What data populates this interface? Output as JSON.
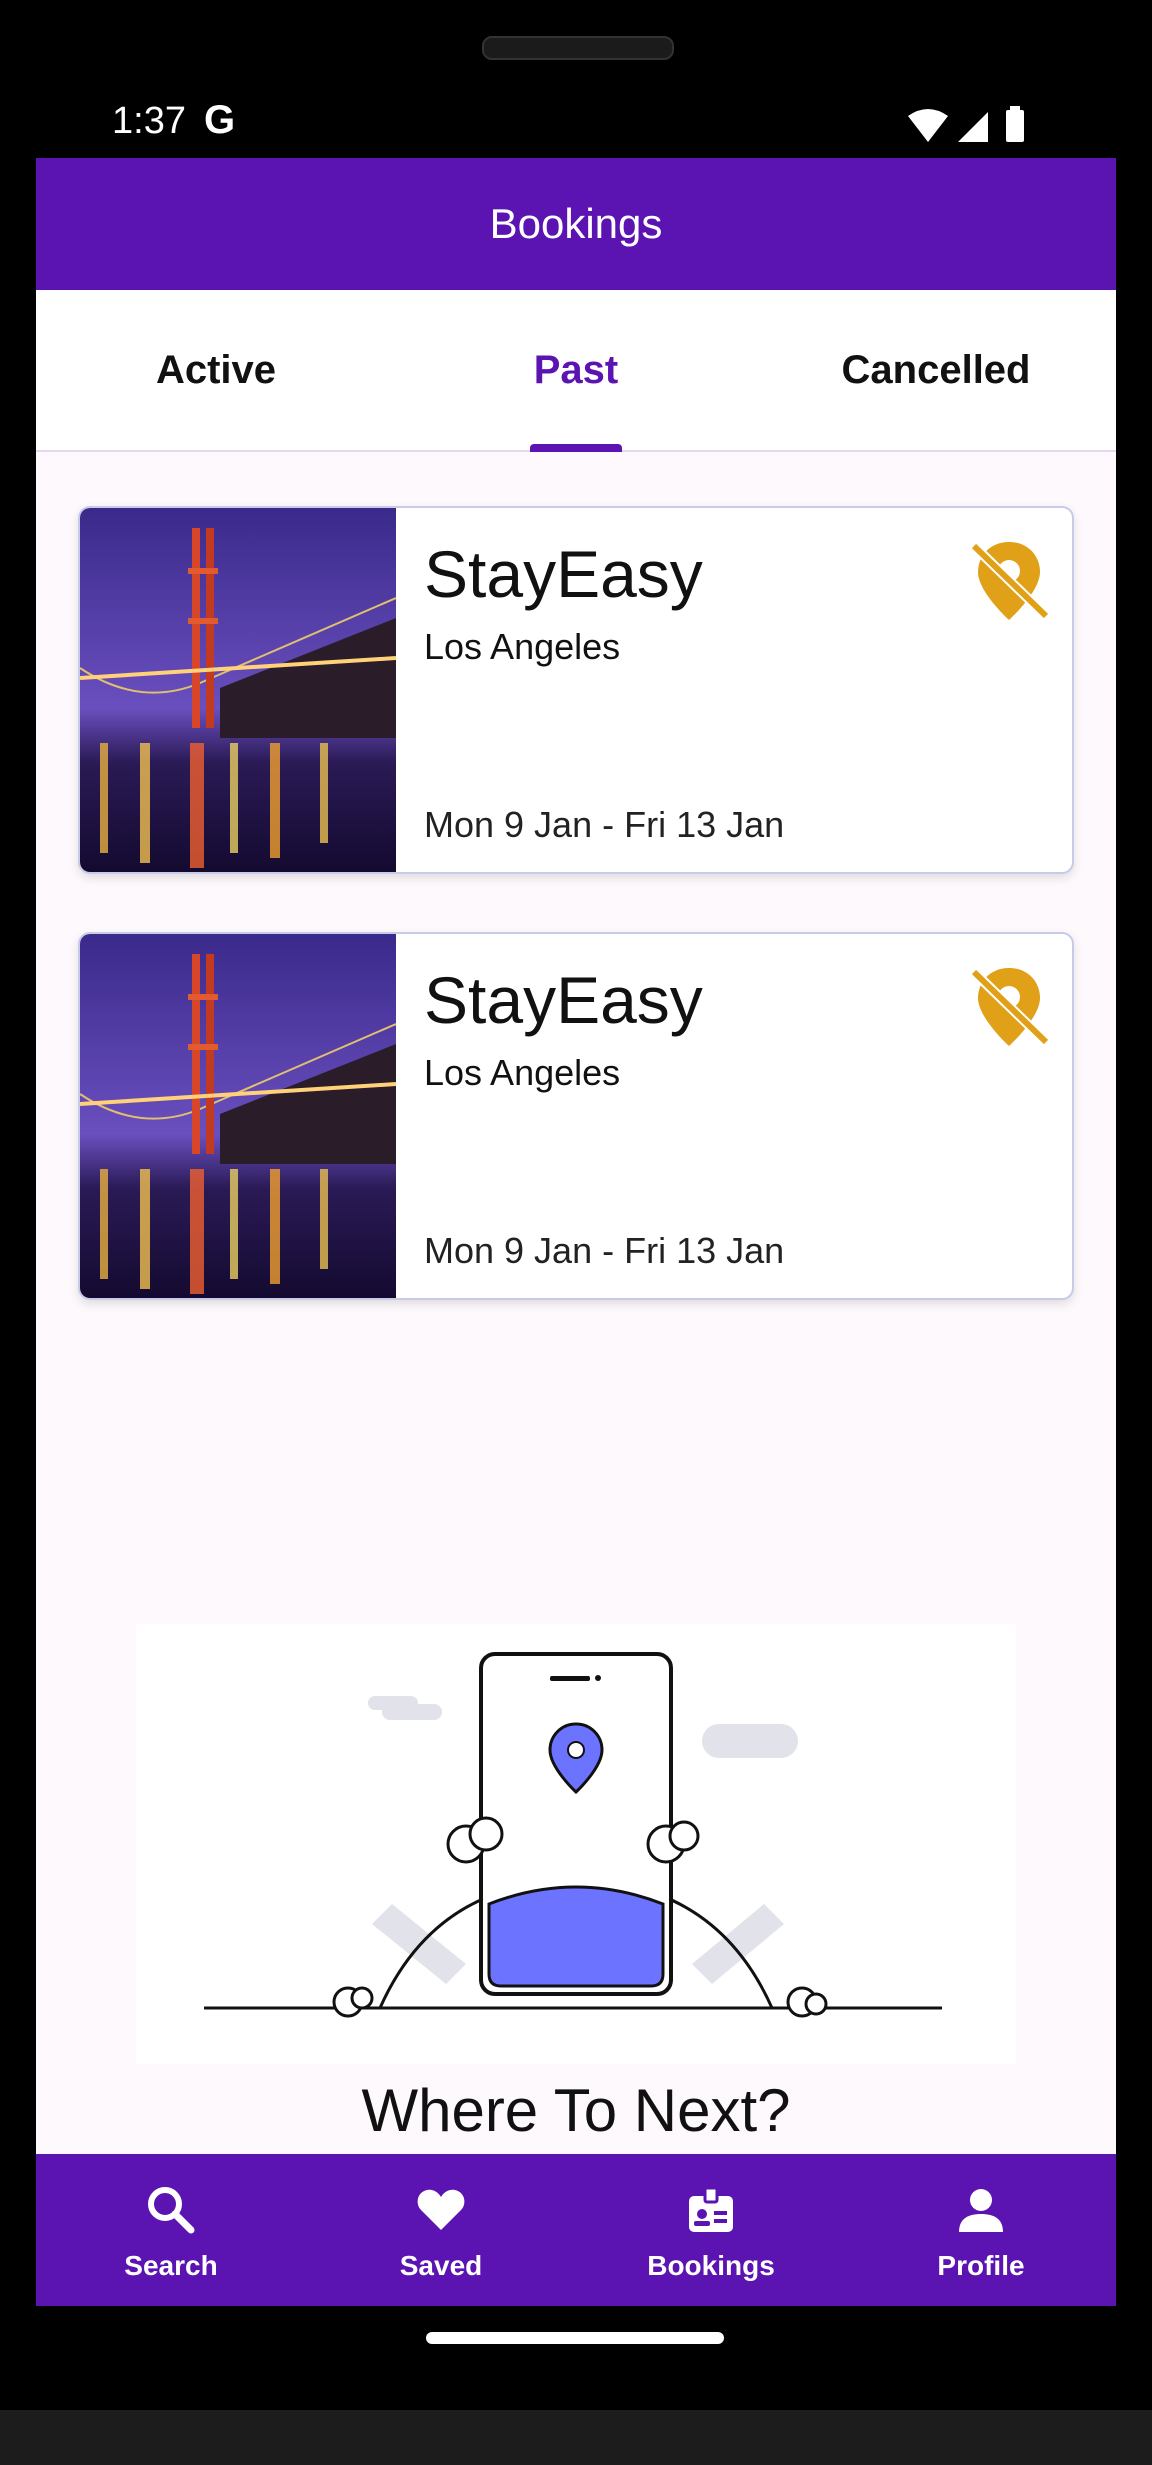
{
  "status_bar": {
    "time": "1:37",
    "g_badge": "G"
  },
  "app_bar": {
    "title": "Bookings"
  },
  "tabs": [
    {
      "label": "Active"
    },
    {
      "label": "Past"
    },
    {
      "label": "Cancelled"
    }
  ],
  "selected_tab": "Past",
  "bookings": [
    {
      "name": "StayEasy",
      "location": "Los Angeles",
      "dates": "Mon 9 Jan - Fri 13 Jan",
      "icon": "location-off-icon"
    },
    {
      "name": "StayEasy",
      "location": "Los Angeles",
      "dates": "Mon 9 Jan - Fri 13 Jan",
      "icon": "location-off-icon"
    }
  ],
  "empty_state": {
    "heading": "Where To Next?"
  },
  "bottom_nav": [
    {
      "label": "Search",
      "icon": "search-icon"
    },
    {
      "label": "Saved",
      "icon": "heart-icon"
    },
    {
      "label": "Bookings",
      "icon": "badge-icon"
    },
    {
      "label": "Profile",
      "icon": "person-icon"
    }
  ],
  "colors": {
    "primary": "#5b14b1",
    "pin_off": "#e0a017",
    "illustration_accent": "#6c74ff"
  }
}
